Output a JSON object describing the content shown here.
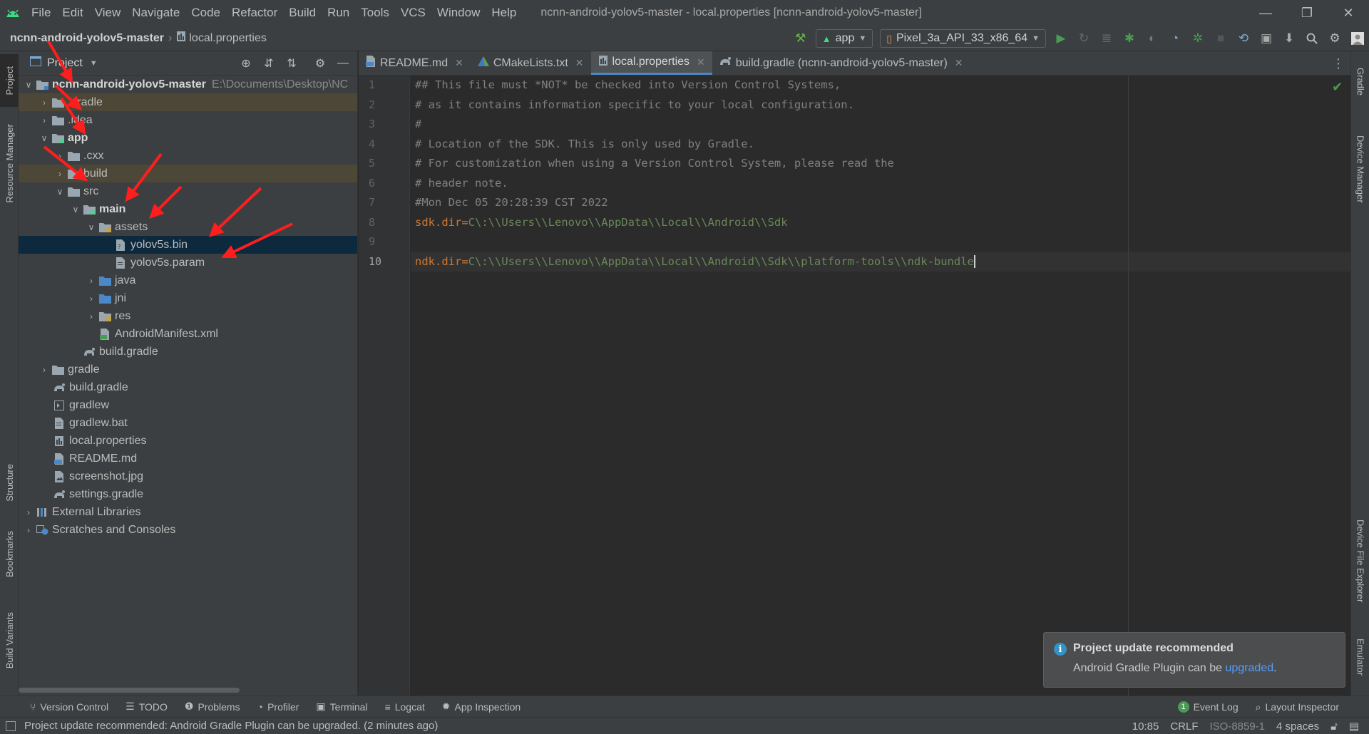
{
  "menubar": {
    "items": [
      "File",
      "Edit",
      "View",
      "Navigate",
      "Code",
      "Refactor",
      "Build",
      "Run",
      "Tools",
      "VCS",
      "Window",
      "Help"
    ],
    "window_title": "ncnn-android-yolov5-master - local.properties [ncnn-android-yolov5-master]",
    "minimize": "—",
    "restore": "❐",
    "close": "✕"
  },
  "navbar": {
    "breadcrumb_root": "ncnn-android-yolov5-master",
    "breadcrumb_file": "local.properties",
    "run_config": "app",
    "device": "Pixel_3a_API_33_x86_64"
  },
  "left_strip": {
    "project": "Project",
    "resource_manager": "Resource Manager",
    "structure": "Structure",
    "bookmarks": "Bookmarks",
    "build_variants": "Build Variants"
  },
  "right_strip": {
    "gradle": "Gradle",
    "device_manager": "Device Manager",
    "device_file_explorer": "Device File Explorer",
    "emulator": "Emulator"
  },
  "project_panel": {
    "title": "Project",
    "tree": [
      {
        "label": "ncnn-android-yolov5-master",
        "path": "E:\\Documents\\Desktop\\NC"
      },
      {
        "label": ".gradle"
      },
      {
        "label": ".idea"
      },
      {
        "label": "app"
      },
      {
        "label": ".cxx"
      },
      {
        "label": "build"
      },
      {
        "label": "src"
      },
      {
        "label": "main"
      },
      {
        "label": "assets"
      },
      {
        "label": "yolov5s.bin"
      },
      {
        "label": "yolov5s.param"
      },
      {
        "label": "java"
      },
      {
        "label": "jni"
      },
      {
        "label": "res"
      },
      {
        "label": "AndroidManifest.xml"
      },
      {
        "label": "build.gradle"
      },
      {
        "label": "gradle"
      },
      {
        "label": "build.gradle"
      },
      {
        "label": "gradlew"
      },
      {
        "label": "gradlew.bat"
      },
      {
        "label": "local.properties"
      },
      {
        "label": "README.md"
      },
      {
        "label": "screenshot.jpg"
      },
      {
        "label": "settings.gradle"
      },
      {
        "label": "External Libraries"
      },
      {
        "label": "Scratches and Consoles"
      }
    ]
  },
  "editor": {
    "tabs": [
      {
        "label": "README.md"
      },
      {
        "label": "CMakeLists.txt"
      },
      {
        "label": "local.properties"
      },
      {
        "label": "build.gradle (ncnn-android-yolov5-master)"
      }
    ],
    "line_numbers": [
      "1",
      "2",
      "3",
      "4",
      "5",
      "6",
      "7",
      "8",
      "9",
      "10"
    ],
    "lines": [
      "## This file must *NOT* be checked into Version Control Systems,",
      "# as it contains information specific to your local configuration.",
      "#",
      "# Location of the SDK. This is only used by Gradle.",
      "# For customization when using a Version Control System, please read the",
      "# header note.",
      "#Mon Dec 05 20:28:39 CST 2022"
    ],
    "sdk_key": "sdk.dir",
    "sdk_value": "C\\:\\\\Users\\\\Lenovo\\\\AppData\\\\Local\\\\Android\\\\Sdk",
    "ndk_key": "ndk.dir",
    "ndk_value": "C\\:\\\\Users\\\\Lenovo\\\\AppData\\\\Local\\\\Android\\\\Sdk\\\\platform-tools\\\\ndk-bundle",
    "equals": "="
  },
  "notification": {
    "title": "Project update recommended",
    "body_prefix": "Android Gradle Plugin can be ",
    "link": "upgraded",
    "body_suffix": "."
  },
  "tool_windows": {
    "version_control": "Version Control",
    "todo": "TODO",
    "problems": "Problems",
    "profiler": "Profiler",
    "terminal": "Terminal",
    "logcat": "Logcat",
    "app_inspection": "App Inspection",
    "event_log": "Event Log",
    "event_log_count": "1",
    "layout_inspector": "Layout Inspector"
  },
  "status_bar": {
    "message": "Project update recommended: Android Gradle Plugin can be upgraded. (2 minutes ago)",
    "position": "10:85",
    "line_sep": "CRLF",
    "encoding": "ISO-8859-1",
    "indent": "4 spaces"
  },
  "colors": {
    "background": "#2b2b2b",
    "panel": "#3c3f41",
    "selection": "#0d293e",
    "accent_blue": "#4a88c7",
    "annotation_red": "#ff1e1e",
    "keyword": "#cc7832",
    "string": "#6a8759",
    "comment": "#808080",
    "android_green": "#3ddc84"
  }
}
